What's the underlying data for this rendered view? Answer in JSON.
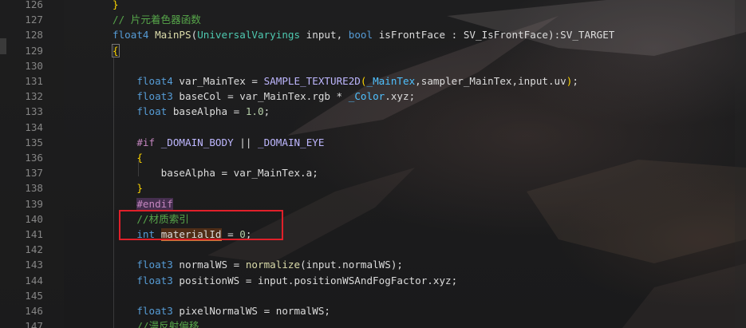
{
  "colors": {
    "keyword": "#569cd6",
    "comment": "#57a64a",
    "function": "#dcdcaa",
    "preprocessor": "#c586c0",
    "macro": "#beb7ff",
    "number": "#b5cea8",
    "brace": "#ffd700",
    "annotation": "#e0202a"
  },
  "lines": [
    {
      "n": "126",
      "tokens": [
        [
          "}",
          "br"
        ]
      ]
    },
    {
      "n": "127",
      "tokens": [
        [
          "// 片元着色器函数",
          "cm"
        ]
      ]
    },
    {
      "n": "128",
      "tokens": [
        [
          "float4",
          "kw"
        ],
        [
          " ",
          ""
        ],
        [
          "MainPS",
          "fn"
        ],
        [
          "(",
          ""
        ],
        [
          "UniversalVaryings",
          "ty"
        ],
        [
          " input, ",
          ""
        ],
        [
          "bool",
          "kw"
        ],
        [
          " isFrontFace : SV_IsFrontFace):SV_TARGET",
          ""
        ]
      ]
    },
    {
      "n": "129",
      "tokens": [
        [
          "{",
          "br-box"
        ]
      ]
    },
    {
      "n": "130",
      "tokens": []
    },
    {
      "n": "131",
      "tokens": [
        [
          "    ",
          ""
        ],
        [
          "float4",
          "kw"
        ],
        [
          " var_MainTex = ",
          ""
        ],
        [
          "SAMPLE_TEXTURE2D",
          "mac"
        ],
        [
          "(",
          "br"
        ],
        [
          "_MainTex",
          "sem"
        ],
        [
          ",sampler_MainTex,input.uv",
          ""
        ],
        [
          ")",
          "br"
        ],
        [
          ";",
          ""
        ]
      ]
    },
    {
      "n": "132",
      "tokens": [
        [
          "    ",
          ""
        ],
        [
          "float3",
          "kw"
        ],
        [
          " baseCol = var_MainTex.rgb * ",
          ""
        ],
        [
          "_Color",
          "sem"
        ],
        [
          ".xyz;",
          ""
        ]
      ]
    },
    {
      "n": "133",
      "tokens": [
        [
          "    ",
          ""
        ],
        [
          "float",
          "kw"
        ],
        [
          " baseAlpha = ",
          ""
        ],
        [
          "1.0",
          "num"
        ],
        [
          ";",
          ""
        ]
      ]
    },
    {
      "n": "134",
      "tokens": []
    },
    {
      "n": "135",
      "tokens": [
        [
          "    ",
          ""
        ],
        [
          "#if",
          "ppk"
        ],
        [
          " ",
          ""
        ],
        [
          "_DOMAIN_BODY",
          "mac"
        ],
        [
          " || ",
          ""
        ],
        [
          "_DOMAIN_EYE",
          "mac"
        ]
      ]
    },
    {
      "n": "136",
      "tokens": [
        [
          "    ",
          ""
        ],
        [
          "{",
          "br"
        ]
      ]
    },
    {
      "n": "137",
      "tokens": [
        [
          "        baseAlpha = var_MainTex.a;",
          ""
        ]
      ]
    },
    {
      "n": "138",
      "tokens": [
        [
          "    ",
          ""
        ],
        [
          "}",
          "br"
        ]
      ]
    },
    {
      "n": "139",
      "tokens": [
        [
          "    ",
          ""
        ],
        [
          "#endif",
          "ppk-hl"
        ]
      ]
    },
    {
      "n": "140",
      "tokens": [
        [
          "    ",
          ""
        ],
        [
          "//材质索引",
          "cm"
        ]
      ]
    },
    {
      "n": "141",
      "tokens": [
        [
          "    ",
          ""
        ],
        [
          "int",
          "kw"
        ],
        [
          " ",
          ""
        ],
        [
          "materialId",
          "ref"
        ],
        [
          " = ",
          ""
        ],
        [
          "0",
          "num"
        ],
        [
          ";",
          ""
        ]
      ]
    },
    {
      "n": "142",
      "tokens": []
    },
    {
      "n": "143",
      "tokens": [
        [
          "    ",
          ""
        ],
        [
          "float3",
          "kw"
        ],
        [
          " normalWS = ",
          ""
        ],
        [
          "normalize",
          "fn"
        ],
        [
          "(input.normalWS);",
          ""
        ]
      ]
    },
    {
      "n": "144",
      "tokens": [
        [
          "    ",
          ""
        ],
        [
          "float3",
          "kw"
        ],
        [
          " positionWS = input.positionWSAndFogFactor.xyz;",
          ""
        ]
      ]
    },
    {
      "n": "145",
      "tokens": []
    },
    {
      "n": "146",
      "tokens": [
        [
          "    ",
          ""
        ],
        [
          "float3",
          "kw"
        ],
        [
          " pixelNormalWS = normalWS;",
          ""
        ]
      ]
    },
    {
      "n": "147",
      "tokens": [
        [
          "    ",
          ""
        ],
        [
          "//漫反射偏移",
          "cm"
        ]
      ]
    }
  ]
}
